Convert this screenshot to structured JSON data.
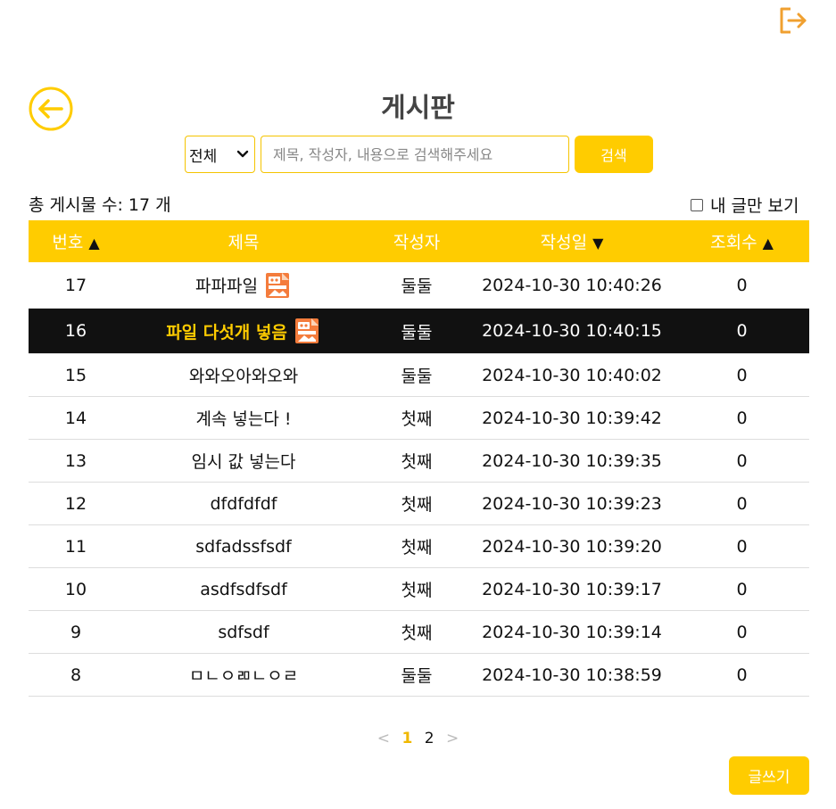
{
  "page": {
    "title": "게시판"
  },
  "search": {
    "scope_value": "전체",
    "placeholder": "제목, 작성자, 내용으로 검색해주세요",
    "button_label": "검색"
  },
  "summary": {
    "total_text": "총 게시물 수: 17 개",
    "mine_label": "내 글만 보기"
  },
  "table": {
    "headers": {
      "no": "번호",
      "no_sort": "▲",
      "title": "제목",
      "author": "작성자",
      "date": "작성일",
      "date_sort": "▼",
      "views": "조회수",
      "views_sort": "▲"
    },
    "rows": [
      {
        "no": "17",
        "title": "파파파일",
        "author": "둘둘",
        "date": "2024-10-30 10:40:26",
        "views": "0",
        "has_image": true
      },
      {
        "no": "16",
        "title": "파일 다섯개 넣음",
        "author": "둘둘",
        "date": "2024-10-30 10:40:15",
        "views": "0",
        "has_image": true
      },
      {
        "no": "15",
        "title": "와와오아와오와",
        "author": "둘둘",
        "date": "2024-10-30 10:40:02",
        "views": "0",
        "has_image": false
      },
      {
        "no": "14",
        "title": "계속 넣는다 !",
        "author": "첫째",
        "date": "2024-10-30 10:39:42",
        "views": "0",
        "has_image": false
      },
      {
        "no": "13",
        "title": "임시 값 넣는다",
        "author": "첫째",
        "date": "2024-10-30 10:39:35",
        "views": "0",
        "has_image": false
      },
      {
        "no": "12",
        "title": "dfdfdfdf",
        "author": "첫째",
        "date": "2024-10-30 10:39:23",
        "views": "0",
        "has_image": false
      },
      {
        "no": "11",
        "title": "sdfadssfsdf",
        "author": "첫째",
        "date": "2024-10-30 10:39:20",
        "views": "0",
        "has_image": false
      },
      {
        "no": "10",
        "title": "asdfsdfsdf",
        "author": "첫째",
        "date": "2024-10-30 10:39:17",
        "views": "0",
        "has_image": false
      },
      {
        "no": "9",
        "title": "sdfsdf",
        "author": "첫째",
        "date": "2024-10-30 10:39:14",
        "views": "0",
        "has_image": false
      },
      {
        "no": "8",
        "title": "ㅁㄴㅇㄻㄴㅇㄹ",
        "author": "둘둘",
        "date": "2024-10-30 10:38:59",
        "views": "0",
        "has_image": false
      }
    ],
    "selected_row": "16"
  },
  "pagination": {
    "prev": "<",
    "pages": [
      "1",
      "2"
    ],
    "current": "1",
    "next": ">"
  },
  "actions": {
    "write_label": "글쓰기"
  },
  "colors": {
    "accent": "#ffcc00",
    "icon_orange": "#f0a030",
    "selected_row_bg": "#111111"
  },
  "icons": {
    "logout": "logout-icon",
    "back": "back-arrow-icon",
    "image": "image-file-icon"
  }
}
